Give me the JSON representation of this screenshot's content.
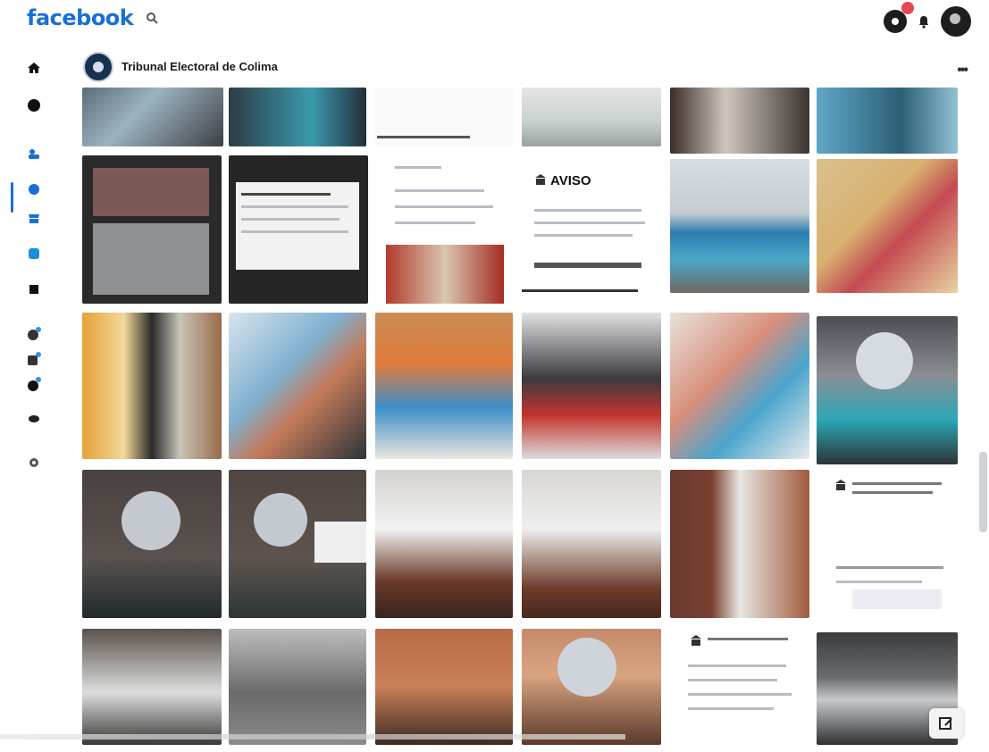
{
  "header": {
    "brand": "facebook",
    "icons": [
      "search-icon",
      "messenger-icon",
      "notifications-icon",
      "account-avatar"
    ]
  },
  "sidebar": {
    "icons": [
      "home-icon",
      "watch-icon",
      "groups-icon",
      "gaming-icon",
      "marketplace-icon",
      "pages-icon",
      "menu-square-icon",
      "shortcut-1-icon",
      "shortcut-2-icon",
      "shortcut-3-icon",
      "shortcut-4-icon",
      "settings-icon"
    ]
  },
  "page": {
    "name": "Tribunal Electoral de Colima",
    "more_label": "•••"
  },
  "grid": {
    "aviso_title": "AVISO"
  },
  "colors": {
    "brand": "#1a6fd6",
    "active": "#1a6fd6",
    "background": "#ffffff"
  }
}
